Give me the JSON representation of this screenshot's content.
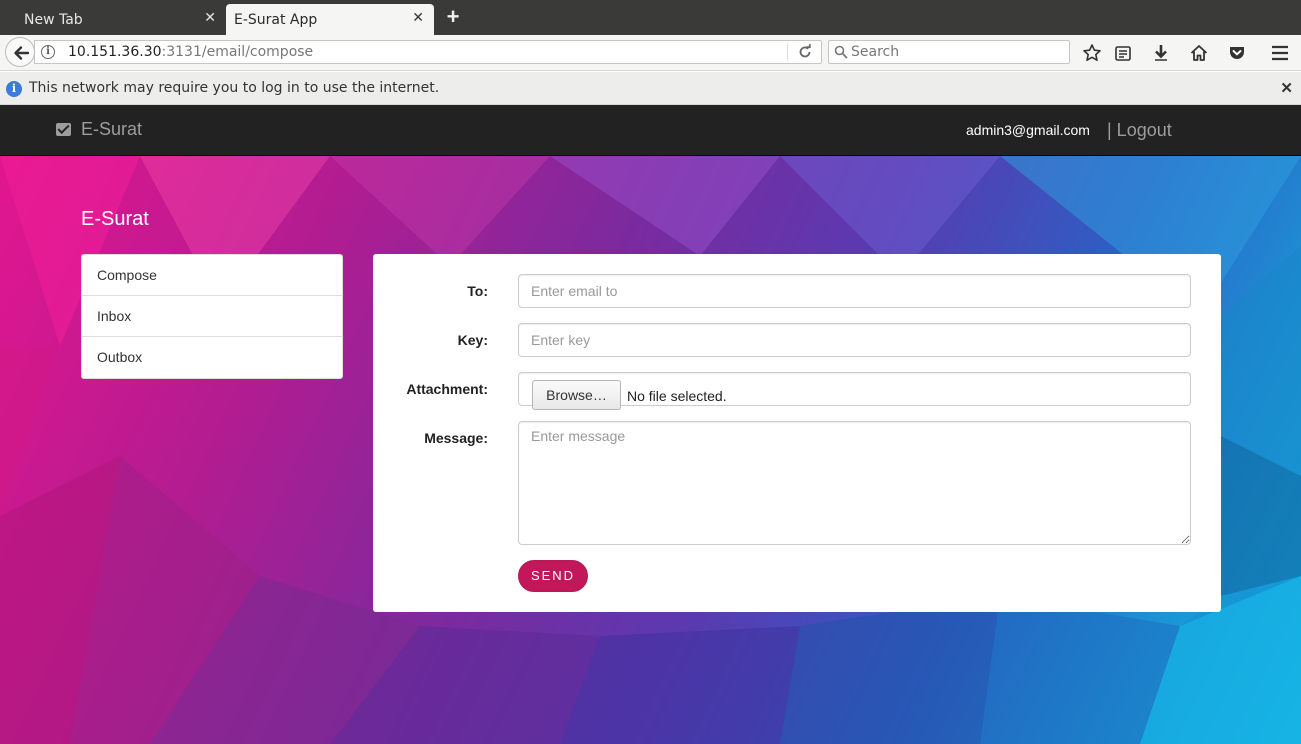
{
  "browser": {
    "tabs": [
      {
        "title": "New Tab",
        "active": false
      },
      {
        "title": "E-Surat App",
        "active": true
      }
    ],
    "new_tab_symbol": "+",
    "tab_close_symbol": "✕",
    "url_host": "10.151.36.30",
    "url_rest": ":3131/email/compose",
    "search_placeholder": "Search",
    "notification": "This network may require you to log in to use the internet.",
    "notification_close": "✕",
    "info_glyph": "i"
  },
  "app": {
    "brand": "E-Surat",
    "user_email": "admin3@gmail.com",
    "logout_label": "| Logout",
    "accent_color": "#c2185b"
  },
  "sidebar": {
    "title": "E-Surat",
    "items": [
      {
        "label": "Compose"
      },
      {
        "label": "Inbox"
      },
      {
        "label": "Outbox"
      }
    ]
  },
  "compose": {
    "to_label": "To:",
    "to_placeholder": "Enter email to",
    "key_label": "Key:",
    "key_placeholder": "Enter key",
    "attachment_label": "Attachment:",
    "browse_label": "Browse…",
    "file_status": "No file selected.",
    "message_label": "Message:",
    "message_placeholder": "Enter message",
    "send_label": "SEND"
  }
}
